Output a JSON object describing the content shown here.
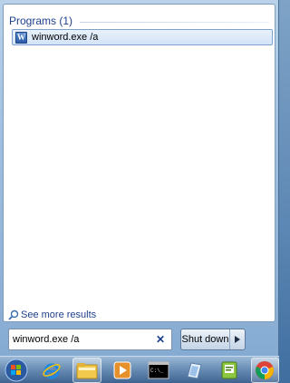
{
  "results": {
    "group_title": "Programs (1)",
    "items": [
      {
        "label": "winword.exe /a",
        "icon": "word-doc-icon"
      }
    ],
    "see_more": "See more results"
  },
  "search": {
    "value": "winword.exe /a",
    "clear_icon": "clear-icon"
  },
  "shutdown": {
    "label": "Shut down",
    "arrow_icon": "right-arrow-icon"
  },
  "taskbar": {
    "items": [
      {
        "name": "start-orb",
        "icon": "windows-logo-icon"
      },
      {
        "name": "internet-explorer",
        "icon": "ie-icon"
      },
      {
        "name": "file-explorer",
        "icon": "folder-icon"
      },
      {
        "name": "media-player",
        "icon": "media-player-icon"
      },
      {
        "name": "command-prompt",
        "icon": "cmd-icon"
      },
      {
        "name": "notebook-app",
        "icon": "notebook-icon"
      },
      {
        "name": "green-app",
        "icon": "green-app-icon"
      },
      {
        "name": "chrome",
        "icon": "chrome-icon"
      }
    ]
  }
}
